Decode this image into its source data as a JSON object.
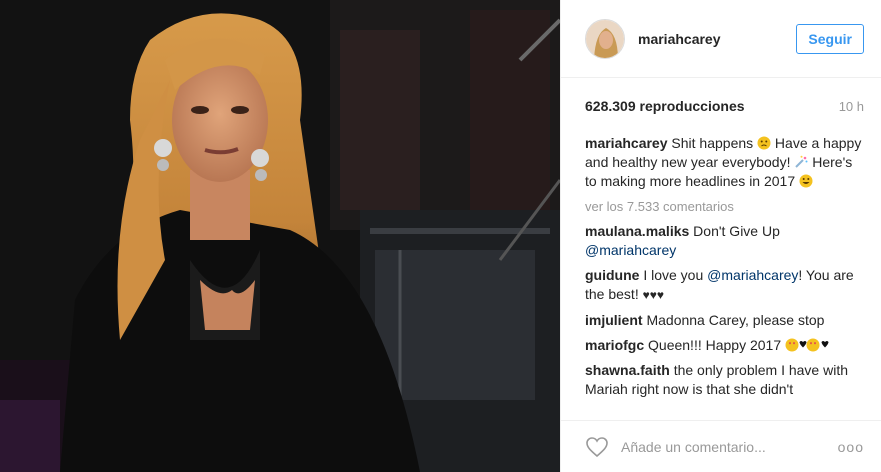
{
  "post": {
    "username": "mariahcarey",
    "follow_label": "Seguir",
    "views": "628.309 reproducciones",
    "time_ago": "10 h",
    "caption_user": "mariahcarey",
    "caption_part1": "Shit happens",
    "caption_part2": "Have a happy and healthy new year everybody!",
    "caption_part3": "Here's to making more headlines in 2017",
    "view_all_comments": "ver los 7.533 comentarios"
  },
  "comments": [
    {
      "user": "maulana.maliks",
      "text": "Don't Give Up",
      "mention": "@mariahcarey"
    },
    {
      "user": "guidune",
      "text_before": "I love you",
      "mention": "@mariahcarey",
      "text_after": "! You are the best!"
    },
    {
      "user": "imjulient",
      "text": "Madonna Carey, please stop"
    },
    {
      "user": "mariofgc",
      "text": "Queen!!! Happy 2017"
    },
    {
      "user": "shawna.faith",
      "text": "the only problem I have with Mariah right now is that she didn't"
    }
  ],
  "footer": {
    "add_comment_placeholder": "Añade un comentario...",
    "more_options": "ooo"
  },
  "icons": {
    "heart": "heart-outline-icon",
    "more": "more-options-icon"
  },
  "colors": {
    "accent": "#3897f0",
    "mention": "#003569",
    "muted": "#999999"
  }
}
